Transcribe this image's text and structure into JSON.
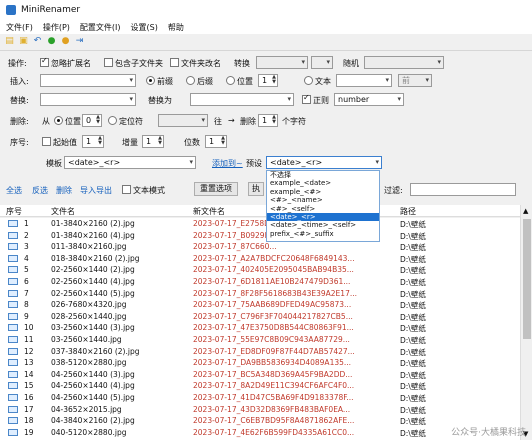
{
  "app": {
    "title": "MiniRenamer"
  },
  "menu": [
    "文件(F)",
    "操作(P)",
    "配置文件(I)",
    "设置(S)",
    "帮助"
  ],
  "toolbar_icons": [
    "new-file-icon",
    "open-folder-icon",
    "undo-icon",
    "run-icon",
    "stop-icon",
    "pin-icon"
  ],
  "options": {
    "label": "操作:",
    "ignore_ext": "忽略扩展名",
    "include_sub": "包含子文件夹",
    "folder_name": "文件夹改名",
    "convert_label": "转换",
    "random_label": "随机"
  },
  "insert": {
    "label": "插入:",
    "front": "前缀",
    "back": "后缀",
    "pos": "位置",
    "pos_val": "1",
    "text": "文本",
    "front_sel": "前"
  },
  "replace": {
    "label": "替换:",
    "with": "替换为",
    "regex": "正则",
    "mode": "number"
  },
  "delete": {
    "label": "删除:",
    "from": "从",
    "pos": "位置",
    "pos_val": "0",
    "locate": "定位符",
    "to": "往",
    "to_arrow": "→",
    "del": "删除",
    "del_val": "1",
    "chars": "个字符"
  },
  "seq": {
    "label": "序号:",
    "start": "起始值",
    "start_val": "1",
    "step": "增量",
    "step_val": "1",
    "digits": "位数",
    "digits_val": "1",
    "template_label": "模板",
    "template_val": "<date>_<r>",
    "add_label": "添加到~",
    "preset_label": "预设",
    "preset_val": "<date>_<r>"
  },
  "dropdown": [
    "不选择",
    "example_<date>",
    "example_<#>",
    "<#>_<name>",
    "<#>_<self>",
    "<date>_<r>",
    "<date>_<time>_<self>",
    "prefix_<#>_suffix"
  ],
  "dropdown_selected": 5,
  "actions": {
    "select_all": "全选",
    "invert": "反选",
    "delete": "删除",
    "import_export": "导入导出",
    "text_mode": "文本模式",
    "reset": "重置选项",
    "apply": "执",
    "filter_label": "过滤:"
  },
  "table": {
    "headers": [
      "序号",
      "文件名",
      "新文件名",
      "路径"
    ],
    "rows": [
      {
        "idx": "1",
        "name": "01-3840×2160 (2).jpg",
        "newname": "2023-07-17_E2758D...",
        "path": "D:\\壁纸"
      },
      {
        "idx": "2",
        "name": "01-3840×2160 (4).jpg",
        "newname": "2023-07-17_B0929D...",
        "path": "D:\\壁纸"
      },
      {
        "idx": "3",
        "name": "011-3840×2160.jpg",
        "newname": "2023-07-17_87C660...",
        "path": "D:\\壁纸"
      },
      {
        "idx": "4",
        "name": "018-3840×2160 (2).jpg",
        "newname": "2023-07-17_A2A7BDCFC20648F6849143...",
        "path": "D:\\壁纸"
      },
      {
        "idx": "5",
        "name": "02-2560×1440 (2).jpg",
        "newname": "2023-07-17_402405E2095045BAB94B35...",
        "path": "D:\\壁纸"
      },
      {
        "idx": "6",
        "name": "02-2560×1440 (4).jpg",
        "newname": "2023-07-17_6D1811AE10B247479D361...",
        "path": "D:\\壁纸"
      },
      {
        "idx": "7",
        "name": "02-2560×1440 (5).jpg",
        "newname": "2023-07-17_8F28F5618683B43E39A2E17...",
        "path": "D:\\壁纸"
      },
      {
        "idx": "8",
        "name": "026-7680×4320.jpg",
        "newname": "2023-07-17_75AAB689DFED49AC95873...",
        "path": "D:\\壁纸"
      },
      {
        "idx": "9",
        "name": "028-2560×1440.jpg",
        "newname": "2023-07-17_C796F3F704044217827CB5...",
        "path": "D:\\壁纸"
      },
      {
        "idx": "10",
        "name": "03-2560×1440 (3).jpg",
        "newname": "2023-07-17_47E3750D8B544C80863F91...",
        "path": "D:\\壁纸"
      },
      {
        "idx": "11",
        "name": "03-2560×1440.jpg",
        "newname": "2023-07-17_55E97C8B09C943AA87729...",
        "path": "D:\\壁纸"
      },
      {
        "idx": "12",
        "name": "037-3840×2160 (2).jpg",
        "newname": "2023-07-17_ED8DF09F87F44D7AB57427...",
        "path": "D:\\壁纸"
      },
      {
        "idx": "13",
        "name": "038-5120×2880.jpg",
        "newname": "2023-07-17_DA9BB5836934D4089A135...",
        "path": "D:\\壁纸"
      },
      {
        "idx": "14",
        "name": "04-2560×1440 (3).jpg",
        "newname": "2023-07-17_BC5A348D369A45F9BA2DD...",
        "path": "D:\\壁纸"
      },
      {
        "idx": "15",
        "name": "04-2560×1440 (4).jpg",
        "newname": "2023-07-17_8A2D49E11C394CF6AFC4F0...",
        "path": "D:\\壁纸"
      },
      {
        "idx": "16",
        "name": "04-2560×1440 (5).jpg",
        "newname": "2023-07-17_41D47C5BA69F4D9183378F...",
        "path": "D:\\壁纸"
      },
      {
        "idx": "17",
        "name": "04-3652×2015.jpg",
        "newname": "2023-07-17_43D32D8369FB483BAF0EA...",
        "path": "D:\\壁纸"
      },
      {
        "idx": "18",
        "name": "04-3840×2160 (2).jpg",
        "newname": "2023-07-17_C6EB7BD95F8A4871862AFE...",
        "path": "D:\\壁纸"
      },
      {
        "idx": "19",
        "name": "040-5120×2880.jpg",
        "newname": "2023-07-17_4E62F6B599FD4335A61CC0...",
        "path": "D:\\壁纸"
      }
    ]
  },
  "watermark": "公众号·大橘果科技"
}
